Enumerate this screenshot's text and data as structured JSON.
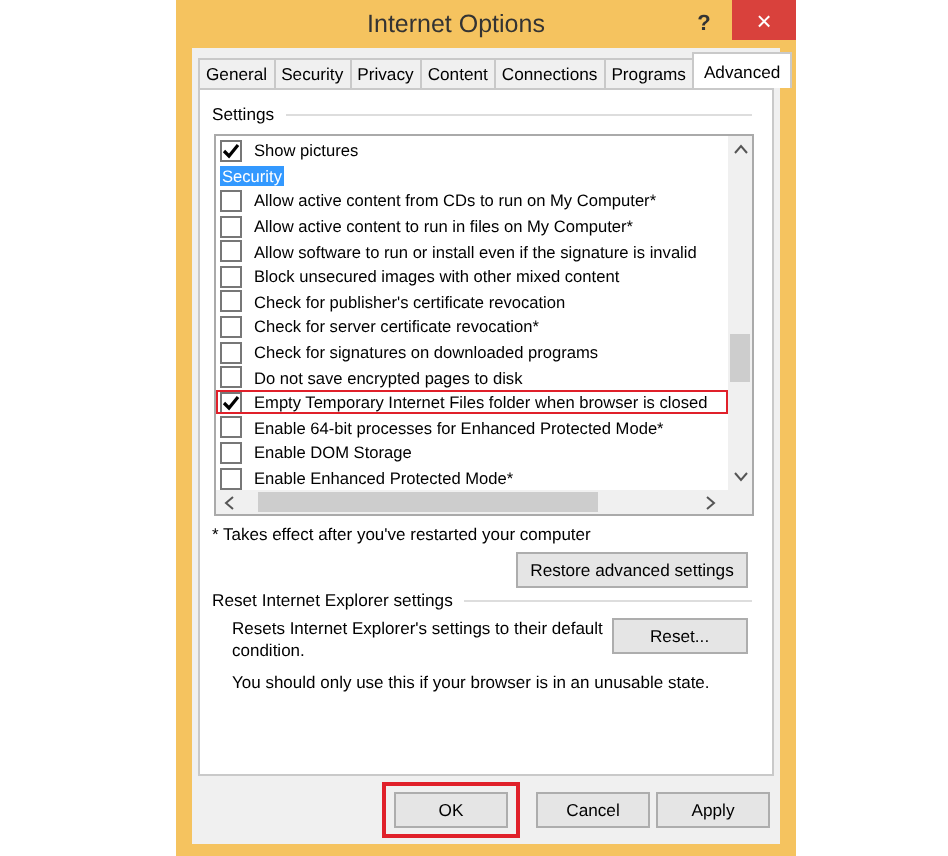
{
  "window": {
    "title": "Internet Options",
    "help": "?",
    "close": "×"
  },
  "tabs": [
    {
      "label": "General",
      "selected": false
    },
    {
      "label": "Security",
      "selected": false
    },
    {
      "label": "Privacy",
      "selected": false
    },
    {
      "label": "Content",
      "selected": false
    },
    {
      "label": "Connections",
      "selected": false
    },
    {
      "label": "Programs",
      "selected": false
    },
    {
      "label": "Advanced",
      "selected": true
    }
  ],
  "settings": {
    "title": "Settings",
    "items": [
      {
        "kind": "checkbox",
        "label": "Show pictures",
        "checked": true,
        "selected": false,
        "highlighted": false
      },
      {
        "kind": "category",
        "label": "Security",
        "selected": true
      },
      {
        "kind": "checkbox",
        "label": "Allow active content from CDs to run on My Computer*",
        "checked": false,
        "selected": false,
        "highlighted": false
      },
      {
        "kind": "checkbox",
        "label": "Allow active content to run in files on My Computer*",
        "checked": false,
        "selected": false,
        "highlighted": false
      },
      {
        "kind": "checkbox",
        "label": "Allow software to run or install even if the signature is invalid",
        "checked": false,
        "selected": false,
        "highlighted": false
      },
      {
        "kind": "checkbox",
        "label": "Block unsecured images with other mixed content",
        "checked": false,
        "selected": false,
        "highlighted": false
      },
      {
        "kind": "checkbox",
        "label": "Check for publisher's certificate revocation",
        "checked": false,
        "selected": false,
        "highlighted": false
      },
      {
        "kind": "checkbox",
        "label": "Check for server certificate revocation*",
        "checked": false,
        "selected": false,
        "highlighted": false
      },
      {
        "kind": "checkbox",
        "label": "Check for signatures on downloaded programs",
        "checked": false,
        "selected": false,
        "highlighted": false
      },
      {
        "kind": "checkbox",
        "label": "Do not save encrypted pages to disk",
        "checked": false,
        "selected": false,
        "highlighted": false
      },
      {
        "kind": "checkbox",
        "label": "Empty Temporary Internet Files folder when browser is closed",
        "checked": true,
        "selected": false,
        "highlighted": true
      },
      {
        "kind": "checkbox",
        "label": "Enable 64-bit processes for Enhanced Protected Mode*",
        "checked": false,
        "selected": false,
        "highlighted": false
      },
      {
        "kind": "checkbox",
        "label": "Enable DOM Storage",
        "checked": false,
        "selected": false,
        "highlighted": false
      },
      {
        "kind": "checkbox",
        "label": "Enable Enhanced Protected Mode*",
        "checked": false,
        "selected": false,
        "highlighted": false
      }
    ],
    "note": "* Takes effect after you've restarted your computer",
    "restore_button": "Restore advanced settings"
  },
  "reset": {
    "title": "Reset Internet Explorer settings",
    "description": "Resets Internet Explorer's settings to their default condition.",
    "button": "Reset...",
    "warning": "You should only use this if your browser is in an unusable state."
  },
  "buttons": [
    {
      "label": "OK",
      "highlighted": true
    },
    {
      "label": "Cancel",
      "highlighted": false
    },
    {
      "label": "Apply",
      "highlighted": false
    }
  ]
}
